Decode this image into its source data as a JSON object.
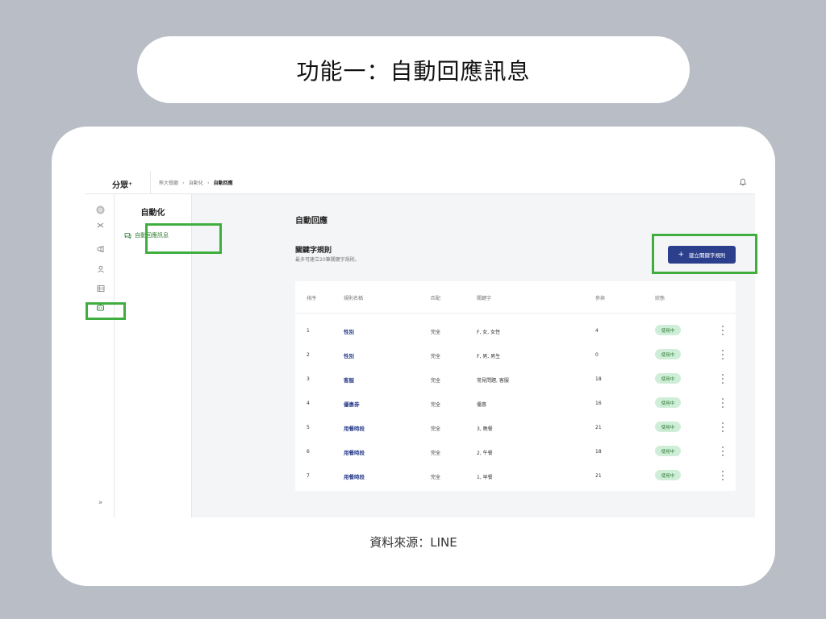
{
  "slide_title": "功能一：自動回應訊息",
  "source_caption": "資料來源：LINE",
  "app": {
    "logo": "分眾⁺",
    "breadcrumbs": [
      "熊大餐廳",
      "自動化",
      "自動回應"
    ],
    "breadcrumb_sep": "›"
  },
  "sidebar": {
    "icons": [
      "avatar",
      "shuffle-icon",
      "megaphone-icon",
      "user-icon",
      "list-icon",
      "bot-icon"
    ],
    "expand": "»"
  },
  "submenu": {
    "title": "自動化",
    "items": [
      {
        "label": "自動回應訊息",
        "icon": "chat-icon"
      }
    ]
  },
  "main": {
    "title": "自動回應",
    "section_title": "關鍵字規則",
    "section_subtitle": "最多可建立20筆關鍵字規則。",
    "create_button": "建立關鍵字規則",
    "create_icon": "+"
  },
  "table": {
    "headers": [
      "排序",
      "規則名稱",
      "匹配",
      "關鍵字",
      "參與",
      "狀態"
    ],
    "rows": [
      {
        "order": "1",
        "name": "性別",
        "match": "完全",
        "keywords": "F, 女, 女性",
        "count": "4",
        "status": "使用中"
      },
      {
        "order": "2",
        "name": "性別",
        "match": "完全",
        "keywords": "F, 男, 男生",
        "count": "0",
        "status": "使用中"
      },
      {
        "order": "3",
        "name": "客服",
        "match": "完全",
        "keywords": "常見問題, 客服",
        "count": "18",
        "status": "使用中"
      },
      {
        "order": "4",
        "name": "優惠券",
        "match": "完全",
        "keywords": "優惠",
        "count": "16",
        "status": "使用中"
      },
      {
        "order": "5",
        "name": "用餐時段",
        "match": "完全",
        "keywords": "3, 晚餐",
        "count": "21",
        "status": "使用中"
      },
      {
        "order": "6",
        "name": "用餐時段",
        "match": "完全",
        "keywords": "2, 午餐",
        "count": "18",
        "status": "使用中"
      },
      {
        "order": "7",
        "name": "用餐時段",
        "match": "完全",
        "keywords": "1, 早餐",
        "count": "21",
        "status": "使用中"
      }
    ]
  },
  "colors": {
    "background": "#b8bdc6",
    "primary_button": "#2c3f8c",
    "highlight": "#3fae3f",
    "badge_bg": "#cfeed8",
    "badge_text": "#2e7d32"
  }
}
